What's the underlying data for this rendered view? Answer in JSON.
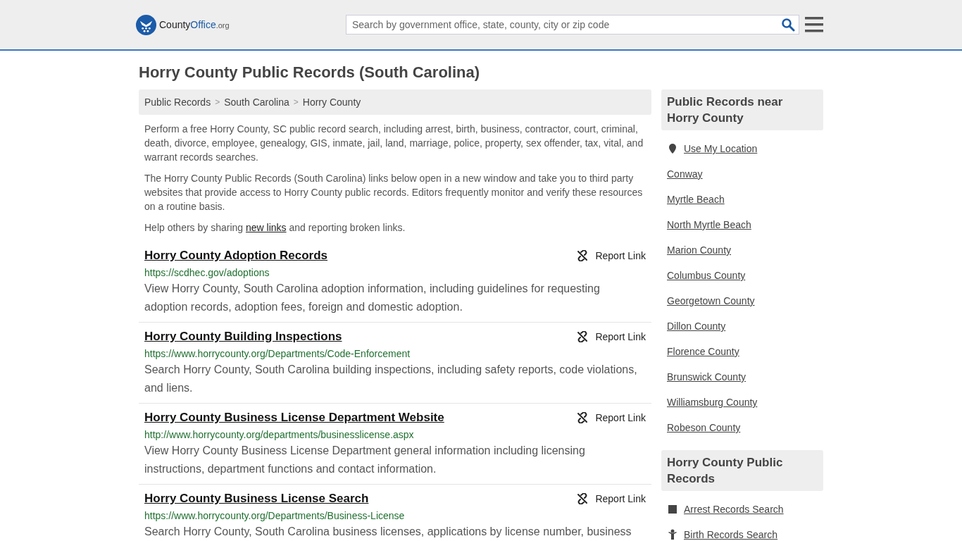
{
  "header": {
    "logo": {
      "name": "County",
      "accent": "Office",
      "suffix": ".org"
    },
    "search": {
      "placeholder": "Search by government office, state, county, city or zip code"
    }
  },
  "title": "Horry County Public Records (South Carolina)",
  "breadcrumbs": [
    "Public Records",
    "South Carolina",
    "Horry County"
  ],
  "breadcrumb_separator": ">",
  "intro": [
    "Perform a free Horry County, SC public record search, including arrest, birth, business, contractor, court, criminal, death, divorce, employee, genealogy, GIS, inmate, jail, land, marriage, police, property, sex offender, tax, vital, and warrant records searches.",
    "The Horry County Public Records (South Carolina) links below open in a new window and take you to third party websites that provide access to Horry County public records. Editors frequently monitor and verify these resources on a routine basis."
  ],
  "help": {
    "before": "Help others by sharing ",
    "link": "new links",
    "after": " and reporting broken links."
  },
  "records": [
    {
      "title": "Horry County Adoption Records",
      "url": "https://scdhec.gov/adoptions",
      "description": "View Horry County, South Carolina adoption information, including guidelines for requesting adoption records, adoption fees, foreign and domestic adoption.",
      "report": "Report Link"
    },
    {
      "title": "Horry County Building Inspections",
      "url": "https://www.horrycounty.org/Departments/Code-Enforcement",
      "description": "Search Horry County, South Carolina building inspections, including safety reports, code violations, and liens.",
      "report": "Report Link"
    },
    {
      "title": "Horry County Business License Department Website",
      "url": "http://www.horrycounty.org/departments/businesslicense.aspx",
      "description": "View Horry County Business License Department general information including licensing instructions, department functions and contact information.",
      "report": "Report Link"
    },
    {
      "title": "Horry County Business License Search",
      "url": "https://www.horrycounty.org/Departments/Business-License",
      "description": "Search Horry County, South Carolina business licenses, applications by license number, business",
      "report": "Report Link"
    }
  ],
  "sidebar": [
    {
      "heading": "Public Records near Horry County",
      "items": [
        {
          "label": "Use My Location",
          "kind": "location"
        },
        {
          "label": "Conway",
          "kind": "plain"
        },
        {
          "label": "Myrtle Beach",
          "kind": "plain"
        },
        {
          "label": "North Myrtle Beach",
          "kind": "plain"
        },
        {
          "label": "Marion County",
          "kind": "plain"
        },
        {
          "label": "Columbus County",
          "kind": "plain"
        },
        {
          "label": "Georgetown County",
          "kind": "plain"
        },
        {
          "label": "Dillon County",
          "kind": "plain"
        },
        {
          "label": "Florence County",
          "kind": "plain"
        },
        {
          "label": "Brunswick County",
          "kind": "plain"
        },
        {
          "label": "Williamsburg County",
          "kind": "plain"
        },
        {
          "label": "Robeson County",
          "kind": "plain"
        }
      ]
    },
    {
      "heading": "Horry County Public Records",
      "items": [
        {
          "label": "Arrest Records Search",
          "kind": "square"
        },
        {
          "label": "Birth Records Search",
          "kind": "baby"
        }
      ]
    }
  ]
}
